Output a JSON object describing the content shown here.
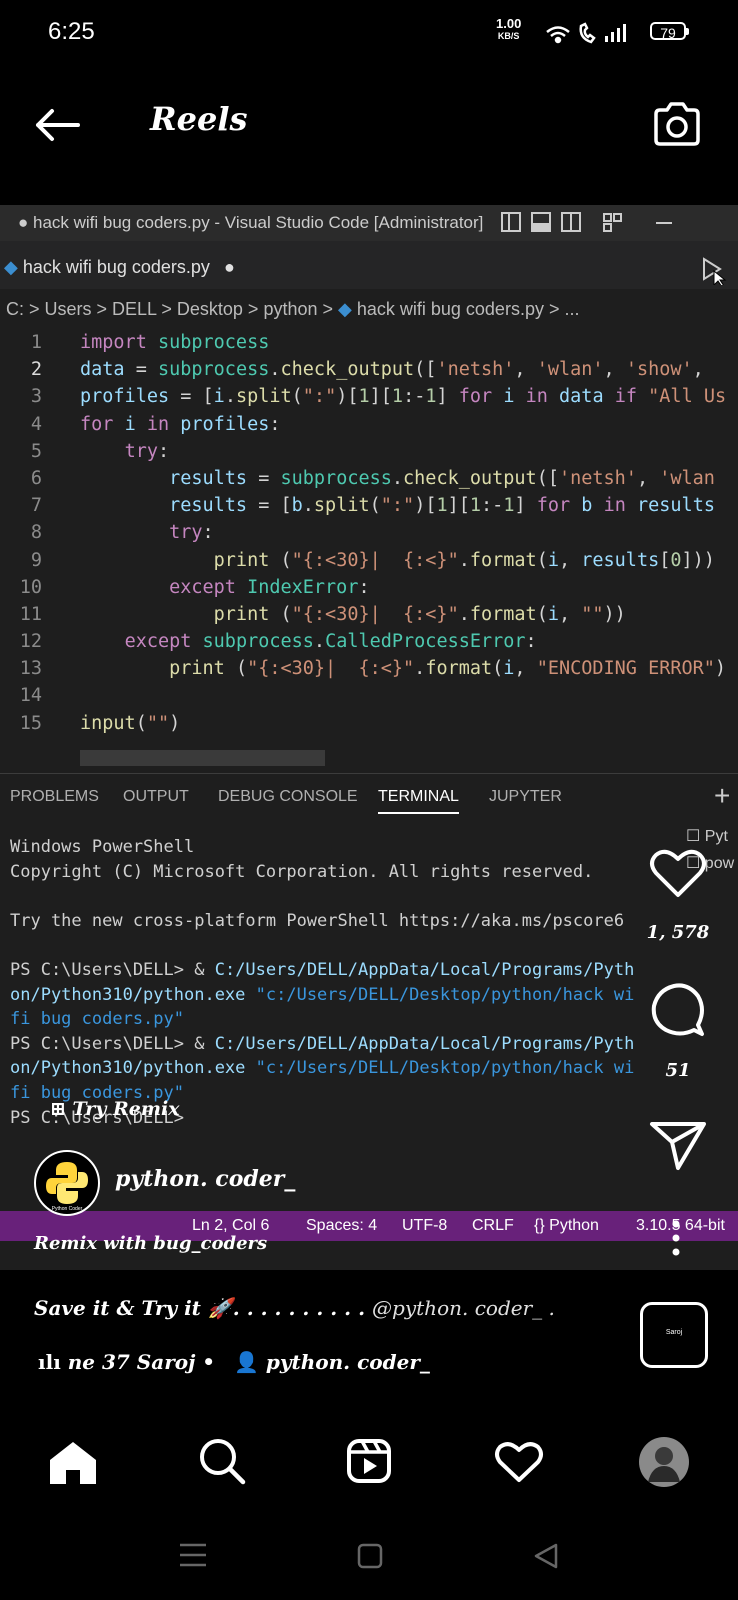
{
  "status_bar": {
    "time": "6:25",
    "net_speed": "1.00",
    "net_speed_unit": "KB/S",
    "battery": "79"
  },
  "header": {
    "title": "Reels",
    "back_icon": "arrow-left-icon",
    "camera_icon": "camera-icon"
  },
  "video": {
    "window_title": "● hack wifi bug coders.py - Visual Studio Code [Administrator]",
    "tab_label": "hack wifi bug coders.py",
    "breadcrumb": "C: > Users > DELL > Desktop > python > ",
    "breadcrumb_file": "hack wifi bug coders.py > ...",
    "line_numbers": [
      "1",
      "2",
      "3",
      "4",
      "5",
      "6",
      "7",
      "8",
      "9",
      "10",
      "11",
      "12",
      "13",
      "14",
      "15"
    ],
    "panel_tabs": [
      "PROBLEMS",
      "OUTPUT",
      "DEBUG CONSOLE",
      "TERMINAL",
      "JUPYTER"
    ],
    "active_panel_tab": "TERMINAL",
    "terminal": {
      "l1": "Windows PowerShell",
      "l2": "Copyright (C) Microsoft Corporation. All rights reserved.",
      "l3": "Try the new cross-platform PowerShell https://aka.ms/pscore6",
      "prompt": "PS C:\\Users\\DELL> ",
      "amp": "& ",
      "exe_a": "C:/Users/DELL/AppData/Local/Programs/Pyth",
      "exe_b": "on/Python310/python.exe ",
      "arg_a": "\"c:/Users/DELL/Desktop/python/hack wi",
      "arg_b": "fi bug coders.py\"",
      "last": "PS C:\\Users\\DELL>"
    },
    "side_panel": [
      "Pyt",
      "pow"
    ],
    "status_bar": {
      "position": "Ln 2, Col 6",
      "spaces": "Spaces: 4",
      "encoding": "UTF-8",
      "eol": "CRLF",
      "language": "Python",
      "version": "3.10.5 64-bit"
    }
  },
  "overlay": {
    "likes": "1, 578",
    "comments": "51",
    "try_remix": "Try Remix",
    "username": "python. coder_",
    "remix_with": "Remix with bug_coders",
    "caption_text": "Save it & Try it 🚀. . . . . . . . . .",
    "caption_mention": "@python. coder_ .",
    "music_text": "ne 37   Saroj •",
    "music_user": "python. coder_",
    "avatar_label": "Python Coder",
    "thumb_label": "Saroj"
  },
  "colors": {
    "vs_status": "#68217a",
    "keyword": "#569cd6",
    "string": "#ce9178"
  }
}
